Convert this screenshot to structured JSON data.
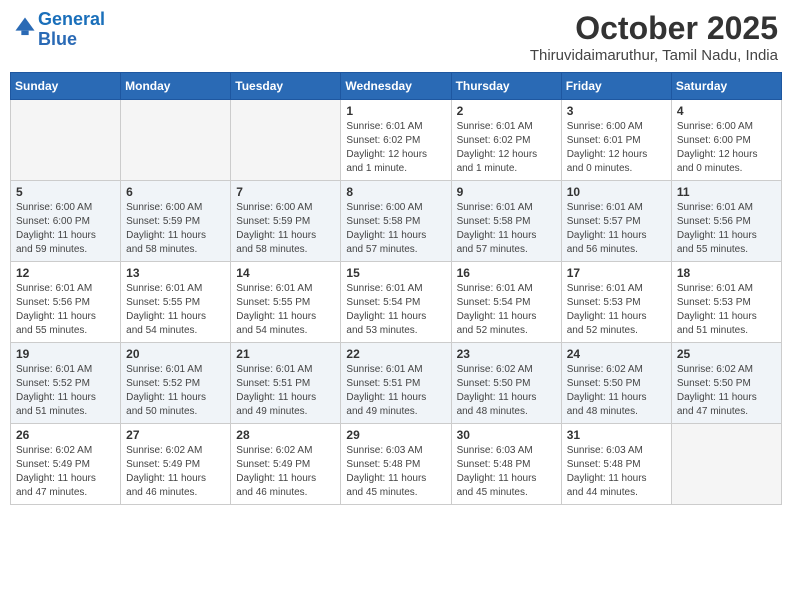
{
  "logo": {
    "line1": "General",
    "line2": "Blue"
  },
  "title": "October 2025",
  "location": "Thiruvidaimaruthur, Tamil Nadu, India",
  "days_of_week": [
    "Sunday",
    "Monday",
    "Tuesday",
    "Wednesday",
    "Thursday",
    "Friday",
    "Saturday"
  ],
  "weeks": [
    [
      {
        "day": "",
        "info": ""
      },
      {
        "day": "",
        "info": ""
      },
      {
        "day": "",
        "info": ""
      },
      {
        "day": "1",
        "info": "Sunrise: 6:01 AM\nSunset: 6:02 PM\nDaylight: 12 hours\nand 1 minute."
      },
      {
        "day": "2",
        "info": "Sunrise: 6:01 AM\nSunset: 6:02 PM\nDaylight: 12 hours\nand 1 minute."
      },
      {
        "day": "3",
        "info": "Sunrise: 6:00 AM\nSunset: 6:01 PM\nDaylight: 12 hours\nand 0 minutes."
      },
      {
        "day": "4",
        "info": "Sunrise: 6:00 AM\nSunset: 6:00 PM\nDaylight: 12 hours\nand 0 minutes."
      }
    ],
    [
      {
        "day": "5",
        "info": "Sunrise: 6:00 AM\nSunset: 6:00 PM\nDaylight: 11 hours\nand 59 minutes."
      },
      {
        "day": "6",
        "info": "Sunrise: 6:00 AM\nSunset: 5:59 PM\nDaylight: 11 hours\nand 58 minutes."
      },
      {
        "day": "7",
        "info": "Sunrise: 6:00 AM\nSunset: 5:59 PM\nDaylight: 11 hours\nand 58 minutes."
      },
      {
        "day": "8",
        "info": "Sunrise: 6:00 AM\nSunset: 5:58 PM\nDaylight: 11 hours\nand 57 minutes."
      },
      {
        "day": "9",
        "info": "Sunrise: 6:01 AM\nSunset: 5:58 PM\nDaylight: 11 hours\nand 57 minutes."
      },
      {
        "day": "10",
        "info": "Sunrise: 6:01 AM\nSunset: 5:57 PM\nDaylight: 11 hours\nand 56 minutes."
      },
      {
        "day": "11",
        "info": "Sunrise: 6:01 AM\nSunset: 5:56 PM\nDaylight: 11 hours\nand 55 minutes."
      }
    ],
    [
      {
        "day": "12",
        "info": "Sunrise: 6:01 AM\nSunset: 5:56 PM\nDaylight: 11 hours\nand 55 minutes."
      },
      {
        "day": "13",
        "info": "Sunrise: 6:01 AM\nSunset: 5:55 PM\nDaylight: 11 hours\nand 54 minutes."
      },
      {
        "day": "14",
        "info": "Sunrise: 6:01 AM\nSunset: 5:55 PM\nDaylight: 11 hours\nand 54 minutes."
      },
      {
        "day": "15",
        "info": "Sunrise: 6:01 AM\nSunset: 5:54 PM\nDaylight: 11 hours\nand 53 minutes."
      },
      {
        "day": "16",
        "info": "Sunrise: 6:01 AM\nSunset: 5:54 PM\nDaylight: 11 hours\nand 52 minutes."
      },
      {
        "day": "17",
        "info": "Sunrise: 6:01 AM\nSunset: 5:53 PM\nDaylight: 11 hours\nand 52 minutes."
      },
      {
        "day": "18",
        "info": "Sunrise: 6:01 AM\nSunset: 5:53 PM\nDaylight: 11 hours\nand 51 minutes."
      }
    ],
    [
      {
        "day": "19",
        "info": "Sunrise: 6:01 AM\nSunset: 5:52 PM\nDaylight: 11 hours\nand 51 minutes."
      },
      {
        "day": "20",
        "info": "Sunrise: 6:01 AM\nSunset: 5:52 PM\nDaylight: 11 hours\nand 50 minutes."
      },
      {
        "day": "21",
        "info": "Sunrise: 6:01 AM\nSunset: 5:51 PM\nDaylight: 11 hours\nand 49 minutes."
      },
      {
        "day": "22",
        "info": "Sunrise: 6:01 AM\nSunset: 5:51 PM\nDaylight: 11 hours\nand 49 minutes."
      },
      {
        "day": "23",
        "info": "Sunrise: 6:02 AM\nSunset: 5:50 PM\nDaylight: 11 hours\nand 48 minutes."
      },
      {
        "day": "24",
        "info": "Sunrise: 6:02 AM\nSunset: 5:50 PM\nDaylight: 11 hours\nand 48 minutes."
      },
      {
        "day": "25",
        "info": "Sunrise: 6:02 AM\nSunset: 5:50 PM\nDaylight: 11 hours\nand 47 minutes."
      }
    ],
    [
      {
        "day": "26",
        "info": "Sunrise: 6:02 AM\nSunset: 5:49 PM\nDaylight: 11 hours\nand 47 minutes."
      },
      {
        "day": "27",
        "info": "Sunrise: 6:02 AM\nSunset: 5:49 PM\nDaylight: 11 hours\nand 46 minutes."
      },
      {
        "day": "28",
        "info": "Sunrise: 6:02 AM\nSunset: 5:49 PM\nDaylight: 11 hours\nand 46 minutes."
      },
      {
        "day": "29",
        "info": "Sunrise: 6:03 AM\nSunset: 5:48 PM\nDaylight: 11 hours\nand 45 minutes."
      },
      {
        "day": "30",
        "info": "Sunrise: 6:03 AM\nSunset: 5:48 PM\nDaylight: 11 hours\nand 45 minutes."
      },
      {
        "day": "31",
        "info": "Sunrise: 6:03 AM\nSunset: 5:48 PM\nDaylight: 11 hours\nand 44 minutes."
      },
      {
        "day": "",
        "info": ""
      }
    ]
  ]
}
